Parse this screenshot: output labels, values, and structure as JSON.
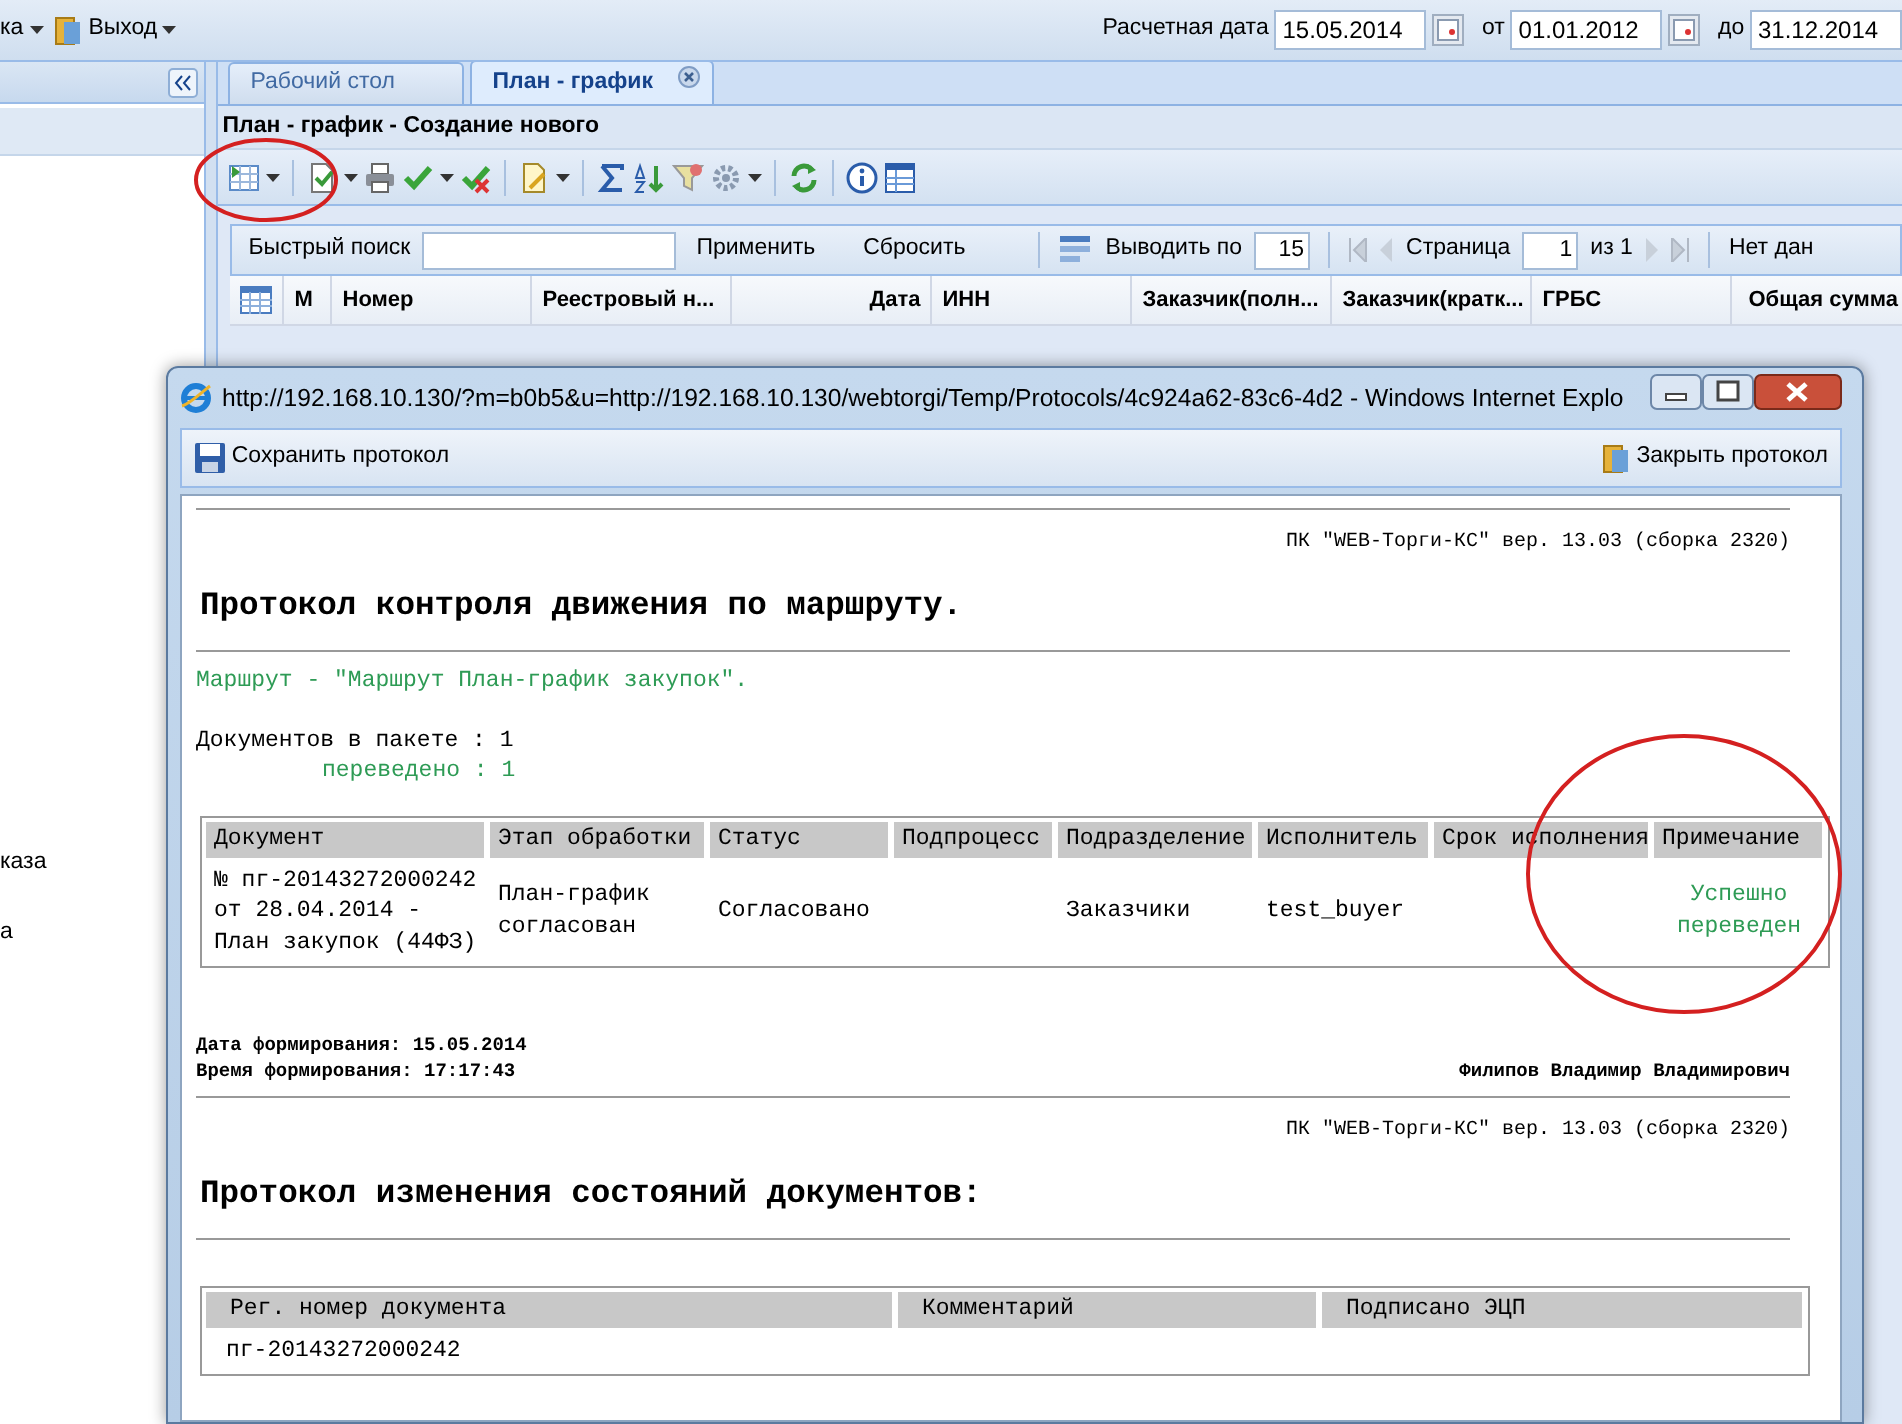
{
  "top_bar": {
    "menus": [
      {
        "label": "ка",
        "kind": "text"
      },
      {
        "label": "Выход",
        "kind": "exit"
      }
    ],
    "date_filters": [
      {
        "label": "Расчетная дата",
        "value": "15.05.2014",
        "calendar": true
      },
      {
        "label": "от",
        "value": "01.01.2012",
        "calendar": true
      },
      {
        "label": "до",
        "value": "31.12.2014",
        "calendar": false
      }
    ]
  },
  "sidebar": {
    "items": [
      {
        "label": "каза"
      },
      {
        "label": "а"
      }
    ]
  },
  "tabs": [
    {
      "label": "Рабочий стол",
      "selected": false,
      "closable": false
    },
    {
      "label": "План - график",
      "selected": true,
      "closable": true
    }
  ],
  "panel_title": "План - график - Создание нового",
  "pager": {
    "search_label": "Быстрый поиск",
    "apply": "Применить",
    "reset": "Сбросить",
    "page_size_label": "Выводить по",
    "page_size": "15",
    "page_label": "Страница",
    "page": "1",
    "page_total": "из 1",
    "status": "Нет дан"
  },
  "grid": {
    "columns": [
      "М",
      "Номер",
      "Реестровый н...",
      "Дата",
      "ИНН",
      "Заказчик(полн...",
      "Заказчик(кратк...",
      "ГРБС",
      "Общая сумма"
    ]
  },
  "popup": {
    "title": "http://192.168.10.130/?m=b0b5&u=http://192.168.10.130/webtorgi/Temp/Protocols/4c924a62-83c6-4d2 - Windows Internet Explo",
    "toolbar": {
      "save": "Сохранить протокол",
      "close": "Закрыть протокол"
    },
    "protocols": [
      {
        "version": "ПК \"WEB-Торги-КС\" вер. 13.03 (сборка 2320)",
        "heading": "Протокол контроля движения по маршруту.",
        "route": "Маршрут - \"Маршрут План-график закупок\".",
        "docs_count": "Документов в пакете : 1",
        "moved": "переведено : 1",
        "table": {
          "columns": [
            "Документ",
            "Этап обработки",
            "Статус",
            "Подпроцесс",
            "Подразделение",
            "Исполнитель",
            "Срок исполнения",
            "Примечание"
          ],
          "rows": [
            {
              "cells": [
                "№ пг-20143272000242 от 28.04.2014 - План закупок (44ФЗ)",
                "План-график согласован",
                "Согласовано",
                "",
                "Заказчики",
                "test_buyer",
                "",
                "Успешно переведен"
              ],
              "kind": "success"
            }
          ]
        },
        "footer": {
          "date": "Дата формирования: 15.05.2014",
          "time": "Время формирования: 17:17:43",
          "signer": "Филипов Владимир Владимирович"
        }
      },
      {
        "version": "ПК \"WEB-Торги-КС\" вер. 13.03 (сборка 2320)",
        "heading": "Протокол изменения состояний документов:",
        "table": {
          "columns": [
            "Рег. номер документа",
            "Комментарий",
            "Подписано ЭЦП"
          ],
          "rows": [
            {
              "cells": [
                "пг-20143272000242",
                "",
                ""
              ]
            }
          ]
        }
      }
    ]
  }
}
